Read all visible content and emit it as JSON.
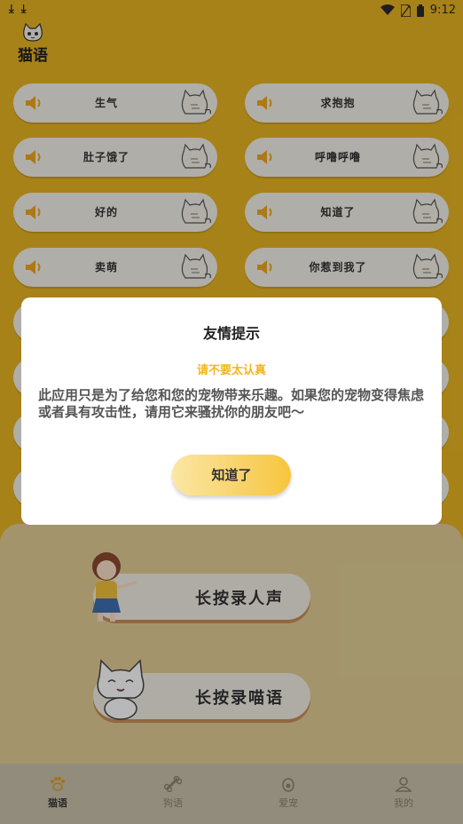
{
  "status_bar": {
    "left_icons": [
      "download-icon",
      "download-icon"
    ],
    "time": "9:12",
    "icons": [
      "wifi-icon",
      "sim-icon",
      "battery-icon"
    ]
  },
  "app": {
    "title": "猫语"
  },
  "sounds": [
    {
      "label": "生气"
    },
    {
      "label": "求抱抱"
    },
    {
      "label": "肚子饿了"
    },
    {
      "label": "呼噜呼噜"
    },
    {
      "label": "好的"
    },
    {
      "label": "知道了"
    },
    {
      "label": "卖萌"
    },
    {
      "label": "你惹到我了"
    }
  ],
  "record": {
    "human_label": "长按录人声",
    "meow_label": "长按录喵语"
  },
  "tabs": [
    {
      "label": "猫语",
      "icon": "paw-icon",
      "active": true
    },
    {
      "label": "狗语",
      "icon": "bone-icon",
      "active": false
    },
    {
      "label": "爱宠",
      "icon": "pet-egg-icon",
      "active": false
    },
    {
      "label": "我的",
      "icon": "user-icon",
      "active": false
    }
  ],
  "dialog": {
    "title": "友情提示",
    "subtitle": "请不要太认真",
    "body": "此应用只是为了给您和您的宠物带来乐趣。如果您的宠物变得焦虑或者具有攻击性，请用它来骚扰你的朋友吧～",
    "button": "知道了"
  },
  "colors": {
    "background": "#e8b523",
    "accent": "#f4b51e",
    "button_gradient_start": "#fbe6a4",
    "button_gradient_end": "#f7c53e"
  }
}
